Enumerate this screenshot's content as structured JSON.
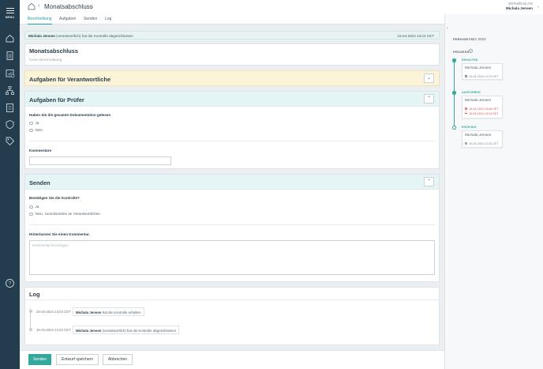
{
  "rail": {
    "menu_label": "MENU",
    "icons": [
      "home-icon",
      "document-icon",
      "calendar-check-icon",
      "org-chart-icon",
      "checklist-icon",
      "shield-icon",
      "tag-icon",
      "help-icon"
    ]
  },
  "header": {
    "title": "Monatsabschluss",
    "company": "ISSTestfirma A/S",
    "user": "Michala Jensen"
  },
  "tabs": [
    {
      "label": "Beschreibung",
      "active": true
    },
    {
      "label": "Aufgaben",
      "active": false
    },
    {
      "label": "Senden",
      "active": false
    },
    {
      "label": "Log",
      "active": false
    }
  ],
  "banner": {
    "user": "Michala Jensen",
    "text": "(verantwortlich) hat die Kontrolle abgeschlossen",
    "timestamp": "15-04-2024 13:24 CET"
  },
  "description": {
    "title": "Monatsabschluss",
    "text": "Keine Beschreibung"
  },
  "responsible_tasks": {
    "title": "Aufgaben für Verantwortliche",
    "toggle": "⌄"
  },
  "auditor_tasks": {
    "title": "Aufgaben für Prüfer",
    "toggle": "⌃",
    "question": "Haben Sie die gesamte Dokumentation gelesen",
    "options": [
      "Ja",
      "Nein"
    ],
    "comment_label": "Kommentare",
    "comment_value": ""
  },
  "send": {
    "title": "Senden",
    "toggle": "⌃",
    "question": "Bestätigen Sie die Kontrolle?",
    "options": [
      "Ja",
      "Nein, zurücksenden an Verantwortlichen"
    ],
    "comment_label": "Hinterlassen Sie einen Kommentar.",
    "comment_placeholder": "Kommentar hinzufügen"
  },
  "log": {
    "title": "Log",
    "entries": [
      {
        "timestamp": "15-04-2024 13:23 CET",
        "user": "Michala Jensen",
        "text": "hat die Kontrolle erhalten"
      },
      {
        "timestamp": "15-04-2024 13:24 CET",
        "user": "Michala Jensen",
        "text": "(verantwortlich) hat die Kontrolle abgeschlossen"
      }
    ]
  },
  "footer": {
    "send": "Senden",
    "save_draft": "Entwurf speichern",
    "cancel": "Abbrechen"
  },
  "sidebar": {
    "periode_label": "PERIODE",
    "periode_value": "März 2024",
    "prozess_label": "PROZESS",
    "info": "i",
    "stages": [
      {
        "label": "ERHALTEN",
        "name": "Michala Jensen",
        "dates": [
          "15-04-2024 13:23 CET"
        ]
      },
      {
        "label": "AUSFÜHREN",
        "name": "Michala Jensen",
        "dates": [
          "16-04-2024 13:46 CET",
          "15-04-2024 13:24 CET"
        ]
      },
      {
        "label": "PRÜFUNG",
        "name": "Michala Jensen",
        "dates": [
          "15-04-2024 13:40 CET"
        ]
      }
    ]
  },
  "colors": {
    "accent": "#35a89d",
    "rail": "#233c4e",
    "warning_header": "#fbf4d8",
    "info_header": "#e5f5f6",
    "overdue": "#d9534f"
  }
}
